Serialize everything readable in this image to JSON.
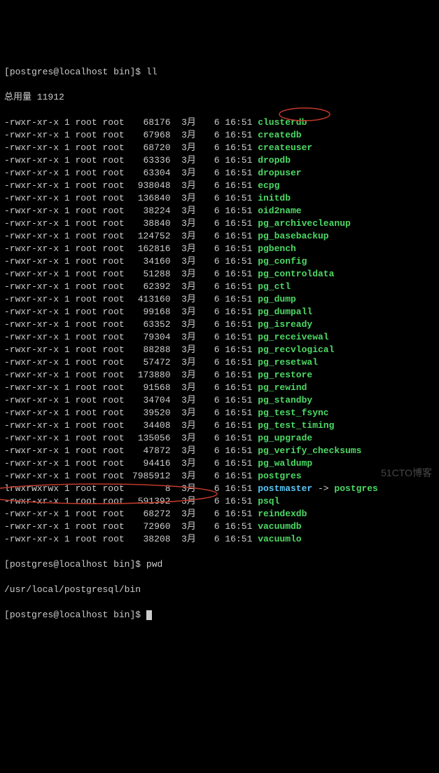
{
  "prompt": {
    "user": "postgres",
    "at": "@",
    "host": "localhost",
    "dir": "bin",
    "symbol": "$"
  },
  "cmd1": "ll",
  "total_label": "总用量 11912",
  "cmd2": "pwd",
  "pwd_output": "/usr/local/postgresql/bin",
  "watermark": "51CTO博客",
  "arrow": " -> ",
  "rows": [
    {
      "perm": "-rwxr-xr-x",
      "links": "1",
      "owner": "root",
      "group": "root",
      "size": "68176",
      "month": "3月",
      "day": "6",
      "time": "16:51",
      "name": "clusterdb",
      "type": "exec"
    },
    {
      "perm": "-rwxr-xr-x",
      "links": "1",
      "owner": "root",
      "group": "root",
      "size": "67968",
      "month": "3月",
      "day": "6",
      "time": "16:51",
      "name": "createdb",
      "type": "exec"
    },
    {
      "perm": "-rwxr-xr-x",
      "links": "1",
      "owner": "root",
      "group": "root",
      "size": "68720",
      "month": "3月",
      "day": "6",
      "time": "16:51",
      "name": "createuser",
      "type": "exec"
    },
    {
      "perm": "-rwxr-xr-x",
      "links": "1",
      "owner": "root",
      "group": "root",
      "size": "63336",
      "month": "3月",
      "day": "6",
      "time": "16:51",
      "name": "dropdb",
      "type": "exec"
    },
    {
      "perm": "-rwxr-xr-x",
      "links": "1",
      "owner": "root",
      "group": "root",
      "size": "63304",
      "month": "3月",
      "day": "6",
      "time": "16:51",
      "name": "dropuser",
      "type": "exec"
    },
    {
      "perm": "-rwxr-xr-x",
      "links": "1",
      "owner": "root",
      "group": "root",
      "size": "938048",
      "month": "3月",
      "day": "6",
      "time": "16:51",
      "name": "ecpg",
      "type": "exec"
    },
    {
      "perm": "-rwxr-xr-x",
      "links": "1",
      "owner": "root",
      "group": "root",
      "size": "136840",
      "month": "3月",
      "day": "6",
      "time": "16:51",
      "name": "initdb",
      "type": "exec"
    },
    {
      "perm": "-rwxr-xr-x",
      "links": "1",
      "owner": "root",
      "group": "root",
      "size": "38224",
      "month": "3月",
      "day": "6",
      "time": "16:51",
      "name": "oid2name",
      "type": "exec"
    },
    {
      "perm": "-rwxr-xr-x",
      "links": "1",
      "owner": "root",
      "group": "root",
      "size": "38840",
      "month": "3月",
      "day": "6",
      "time": "16:51",
      "name": "pg_archivecleanup",
      "type": "exec"
    },
    {
      "perm": "-rwxr-xr-x",
      "links": "1",
      "owner": "root",
      "group": "root",
      "size": "124752",
      "month": "3月",
      "day": "6",
      "time": "16:51",
      "name": "pg_basebackup",
      "type": "exec"
    },
    {
      "perm": "-rwxr-xr-x",
      "links": "1",
      "owner": "root",
      "group": "root",
      "size": "162816",
      "month": "3月",
      "day": "6",
      "time": "16:51",
      "name": "pgbench",
      "type": "exec"
    },
    {
      "perm": "-rwxr-xr-x",
      "links": "1",
      "owner": "root",
      "group": "root",
      "size": "34160",
      "month": "3月",
      "day": "6",
      "time": "16:51",
      "name": "pg_config",
      "type": "exec"
    },
    {
      "perm": "-rwxr-xr-x",
      "links": "1",
      "owner": "root",
      "group": "root",
      "size": "51288",
      "month": "3月",
      "day": "6",
      "time": "16:51",
      "name": "pg_controldata",
      "type": "exec"
    },
    {
      "perm": "-rwxr-xr-x",
      "links": "1",
      "owner": "root",
      "group": "root",
      "size": "62392",
      "month": "3月",
      "day": "6",
      "time": "16:51",
      "name": "pg_ctl",
      "type": "exec"
    },
    {
      "perm": "-rwxr-xr-x",
      "links": "1",
      "owner": "root",
      "group": "root",
      "size": "413160",
      "month": "3月",
      "day": "6",
      "time": "16:51",
      "name": "pg_dump",
      "type": "exec"
    },
    {
      "perm": "-rwxr-xr-x",
      "links": "1",
      "owner": "root",
      "group": "root",
      "size": "99168",
      "month": "3月",
      "day": "6",
      "time": "16:51",
      "name": "pg_dumpall",
      "type": "exec"
    },
    {
      "perm": "-rwxr-xr-x",
      "links": "1",
      "owner": "root",
      "group": "root",
      "size": "63352",
      "month": "3月",
      "day": "6",
      "time": "16:51",
      "name": "pg_isready",
      "type": "exec"
    },
    {
      "perm": "-rwxr-xr-x",
      "links": "1",
      "owner": "root",
      "group": "root",
      "size": "79304",
      "month": "3月",
      "day": "6",
      "time": "16:51",
      "name": "pg_receivewal",
      "type": "exec"
    },
    {
      "perm": "-rwxr-xr-x",
      "links": "1",
      "owner": "root",
      "group": "root",
      "size": "88288",
      "month": "3月",
      "day": "6",
      "time": "16:51",
      "name": "pg_recvlogical",
      "type": "exec"
    },
    {
      "perm": "-rwxr-xr-x",
      "links": "1",
      "owner": "root",
      "group": "root",
      "size": "57472",
      "month": "3月",
      "day": "6",
      "time": "16:51",
      "name": "pg_resetwal",
      "type": "exec"
    },
    {
      "perm": "-rwxr-xr-x",
      "links": "1",
      "owner": "root",
      "group": "root",
      "size": "173880",
      "month": "3月",
      "day": "6",
      "time": "16:51",
      "name": "pg_restore",
      "type": "exec"
    },
    {
      "perm": "-rwxr-xr-x",
      "links": "1",
      "owner": "root",
      "group": "root",
      "size": "91568",
      "month": "3月",
      "day": "6",
      "time": "16:51",
      "name": "pg_rewind",
      "type": "exec"
    },
    {
      "perm": "-rwxr-xr-x",
      "links": "1",
      "owner": "root",
      "group": "root",
      "size": "34704",
      "month": "3月",
      "day": "6",
      "time": "16:51",
      "name": "pg_standby",
      "type": "exec"
    },
    {
      "perm": "-rwxr-xr-x",
      "links": "1",
      "owner": "root",
      "group": "root",
      "size": "39520",
      "month": "3月",
      "day": "6",
      "time": "16:51",
      "name": "pg_test_fsync",
      "type": "exec"
    },
    {
      "perm": "-rwxr-xr-x",
      "links": "1",
      "owner": "root",
      "group": "root",
      "size": "34408",
      "month": "3月",
      "day": "6",
      "time": "16:51",
      "name": "pg_test_timing",
      "type": "exec"
    },
    {
      "perm": "-rwxr-xr-x",
      "links": "1",
      "owner": "root",
      "group": "root",
      "size": "135056",
      "month": "3月",
      "day": "6",
      "time": "16:51",
      "name": "pg_upgrade",
      "type": "exec"
    },
    {
      "perm": "-rwxr-xr-x",
      "links": "1",
      "owner": "root",
      "group": "root",
      "size": "47872",
      "month": "3月",
      "day": "6",
      "time": "16:51",
      "name": "pg_verify_checksums",
      "type": "exec"
    },
    {
      "perm": "-rwxr-xr-x",
      "links": "1",
      "owner": "root",
      "group": "root",
      "size": "94416",
      "month": "3月",
      "day": "6",
      "time": "16:51",
      "name": "pg_waldump",
      "type": "exec"
    },
    {
      "perm": "-rwxr-xr-x",
      "links": "1",
      "owner": "root",
      "group": "root",
      "size": "7985912",
      "month": "3月",
      "day": "6",
      "time": "16:51",
      "name": "postgres",
      "type": "exec"
    },
    {
      "perm": "lrwxrwxrwx",
      "links": "1",
      "owner": "root",
      "group": "root",
      "size": "8",
      "month": "3月",
      "day": "6",
      "time": "16:51",
      "name": "postmaster",
      "type": "link",
      "target": "postgres"
    },
    {
      "perm": "-rwxr-xr-x",
      "links": "1",
      "owner": "root",
      "group": "root",
      "size": "591392",
      "month": "3月",
      "day": "6",
      "time": "16:51",
      "name": "psql",
      "type": "exec"
    },
    {
      "perm": "-rwxr-xr-x",
      "links": "1",
      "owner": "root",
      "group": "root",
      "size": "68272",
      "month": "3月",
      "day": "6",
      "time": "16:51",
      "name": "reindexdb",
      "type": "exec"
    },
    {
      "perm": "-rwxr-xr-x",
      "links": "1",
      "owner": "root",
      "group": "root",
      "size": "72960",
      "month": "3月",
      "day": "6",
      "time": "16:51",
      "name": "vacuumdb",
      "type": "exec"
    },
    {
      "perm": "-rwxr-xr-x",
      "links": "1",
      "owner": "root",
      "group": "root",
      "size": "38208",
      "month": "3月",
      "day": "6",
      "time": "16:51",
      "name": "vacuumlo",
      "type": "exec"
    }
  ]
}
